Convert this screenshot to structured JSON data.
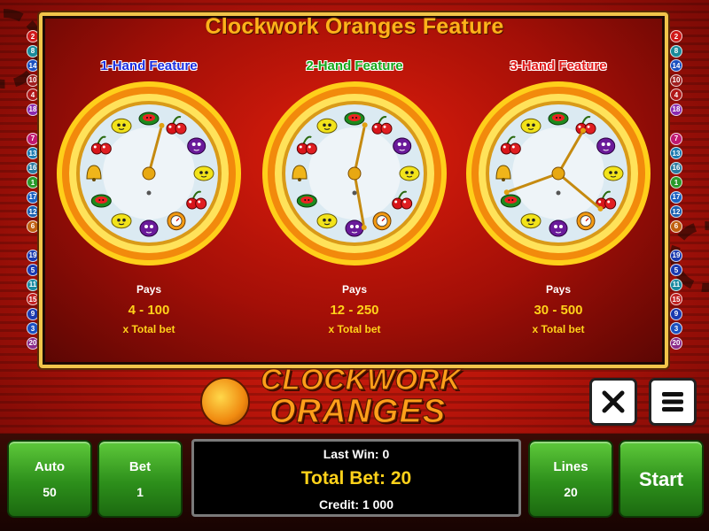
{
  "game": {
    "feature_title": "Clockwork Oranges Feature",
    "logo_line1": "CLOCKWORK",
    "logo_line2": "ORANGES"
  },
  "line_numbers": {
    "left": [
      2,
      8,
      14,
      10,
      4,
      18,
      7,
      13,
      16,
      1,
      17,
      12,
      6,
      19,
      5,
      11,
      15,
      9,
      3,
      20
    ],
    "right": [
      2,
      8,
      14,
      10,
      4,
      18,
      7,
      13,
      16,
      1,
      17,
      12,
      6,
      19,
      5,
      11,
      15,
      9,
      3,
      20
    ],
    "colors": {
      "1": "#2a9a2a",
      "2": "#d01818",
      "3": "#1a50c0",
      "4": "#b01818",
      "5": "#1a3ab0",
      "6": "#c06010",
      "7": "#c01870",
      "8": "#1a8a9a",
      "9": "#1a3ab0",
      "10": "#a02020",
      "11": "#1a8aa0",
      "12": "#1a60b0",
      "13": "#1a7ab0",
      "14": "#1a50c0",
      "15": "#c02020",
      "16": "#2a7aa0",
      "17": "#1a60c0",
      "18": "#8a2ab0",
      "19": "#1a3ab0",
      "20": "#8a2a8a"
    }
  },
  "features": [
    {
      "label": "1-Hand Feature",
      "label_color": "#1a2ee0",
      "hands": 1,
      "pays_title": "Pays",
      "pays_range": "4 - 100",
      "pays_unit": "x Total bet"
    },
    {
      "label": "2-Hand Feature",
      "label_color": "#16a51a",
      "hands": 2,
      "pays_title": "Pays",
      "pays_range": "12 - 250",
      "pays_unit": "x Total bet"
    },
    {
      "label": "3-Hand Feature",
      "label_color": "#e01818",
      "hands": 3,
      "pays_title": "Pays",
      "pays_range": "30 - 500",
      "pays_unit": "x Total bet"
    }
  ],
  "clock_symbols": [
    "cherries",
    "plum",
    "lemon",
    "cherries",
    "oranges",
    "plum",
    "lemon",
    "watermelon",
    "bell",
    "cherries",
    "lemon",
    "watermelon"
  ],
  "controls": {
    "auto_label": "Auto",
    "auto_value": "50",
    "bet_label": "Bet",
    "bet_value": "1",
    "lines_label": "Lines",
    "lines_value": "20",
    "start_label": "Start",
    "last_win": "Last Win: 0",
    "total_bet": "Total Bet: 20",
    "credit": "Credit: 1 000"
  },
  "icons": {
    "close": "close-icon",
    "menu": "menu-icon"
  },
  "colors": {
    "title": "#ffb21a",
    "pays_value": "#ffd21a",
    "button_green": "#2d8f1b",
    "panel_border": "#f1c54a"
  }
}
